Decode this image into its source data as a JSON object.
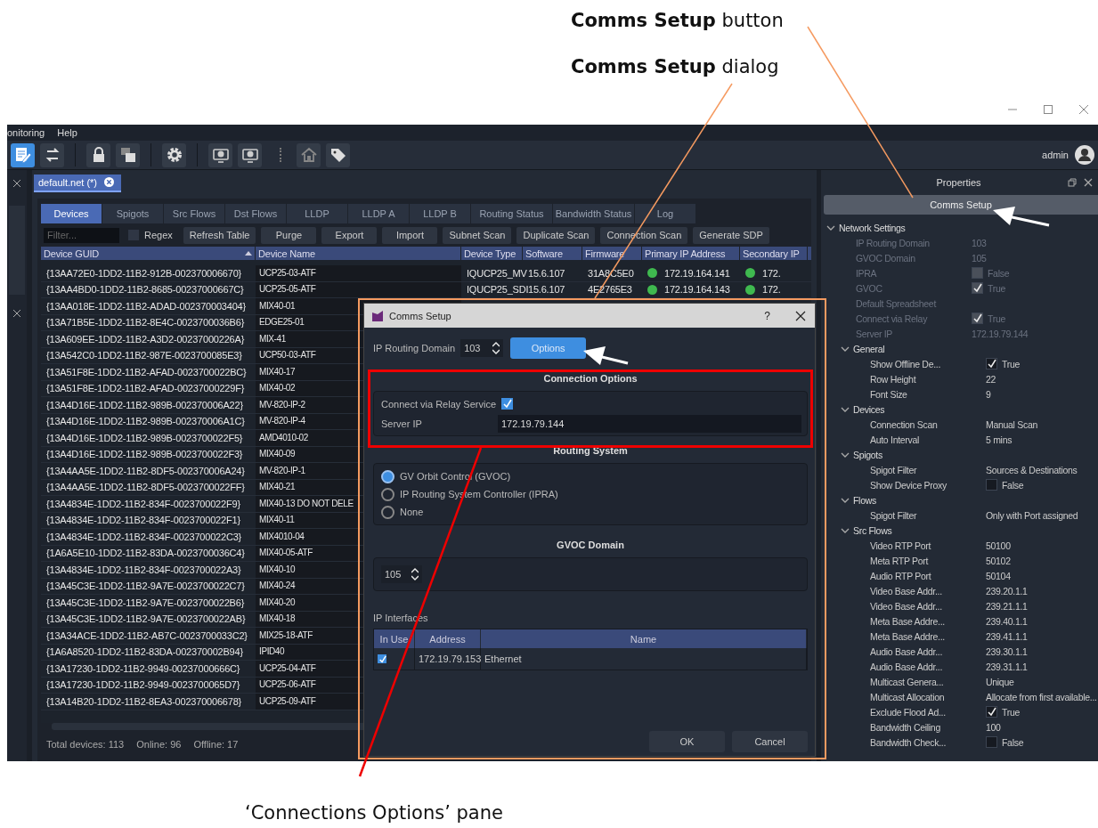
{
  "callouts": [
    {
      "text": "**Comms Setup** button"
    },
    {
      "text": "**Comms Setup** dialog"
    },
    {
      "text": "‘Connections Options’ pane"
    }
  ],
  "menu": [
    "onitoring",
    "Help"
  ],
  "toolbar": [
    {
      "kind": "edit",
      "selected": true
    },
    {
      "kind": "swap",
      "selected": false
    },
    {
      "kind": "lock",
      "selected": false
    },
    {
      "kind": "window",
      "selected": false
    },
    {
      "kind": "gear",
      "selected": false
    },
    {
      "kind": "download",
      "selected": false
    },
    {
      "kind": "upload",
      "selected": false
    },
    {
      "kind": "home",
      "selected": false
    },
    {
      "kind": "tag",
      "selected": false
    }
  ],
  "user": "admin",
  "document_tab": {
    "label": "default.net (*)"
  },
  "tabs": [
    {
      "label": "Devices",
      "selected": true
    },
    {
      "label": "Spigots",
      "selected": false
    },
    {
      "label": "Src Flows",
      "selected": false
    },
    {
      "label": "Dst Flows",
      "selected": false
    },
    {
      "label": "LLDP",
      "selected": false
    },
    {
      "label": "LLDP A",
      "selected": false
    },
    {
      "label": "LLDP B",
      "selected": false
    },
    {
      "label": "Routing Status",
      "selected": false
    },
    {
      "label": "Bandwidth Status",
      "selected": false
    },
    {
      "label": "Log",
      "selected": false
    }
  ],
  "filter": {
    "placeholder": "Filter..."
  },
  "regex": {
    "label": "Regex",
    "checked": false
  },
  "actions": [
    "Refresh Table",
    "Purge",
    "Export",
    "Import",
    "Subnet Scan",
    "Duplicate Scan",
    "Connection Scan",
    "Generate SDP"
  ],
  "table": {
    "columns": [
      "Device GUID",
      "Device Name",
      "Device Type",
      "Software",
      "Firmware",
      "Primary IP Address",
      "Secondary IP"
    ],
    "rows": [
      {
        "guid": "{13AA72E0-1DD2-11B2-912B-002370006670}",
        "name": "UCP25-03-ATF",
        "type": "IQUCP25_MV",
        "software": "15.6.107",
        "firmware": "31A8C5E0",
        "primary_online": true,
        "primary_ip": "172.19.164.141",
        "secondary_online": true,
        "secondary_ip": "172."
      },
      {
        "guid": "{13AA4BD0-1DD2-11B2-8685-00237000667C}",
        "name": "UCP25-05-ATF",
        "type": "IQUCP25_SDI",
        "software": "15.6.107",
        "firmware": "4E2765E3",
        "primary_online": true,
        "primary_ip": "172.19.164.143",
        "secondary_online": true,
        "secondary_ip": "172."
      },
      {
        "guid": "{13AA018E-1DD2-11B2-ADAD-002370003404}",
        "name": "MIX40-01"
      },
      {
        "guid": "{13A71B5E-1DD2-11B2-8E4C-0023700036B6}",
        "name": "EDGE25-01"
      },
      {
        "guid": "{13A609EE-1DD2-11B2-A3D2-00237000226A}",
        "name": "MIX-41"
      },
      {
        "guid": "{13A542C0-1DD2-11B2-987E-0023700085E3}",
        "name": "UCP50-03-ATF"
      },
      {
        "guid": "{13A51F8E-1DD2-11B2-AFAD-0023700022BC}",
        "name": "MIX40-17"
      },
      {
        "guid": "{13A51F8E-1DD2-11B2-AFAD-00237000229F}",
        "name": "MIX40-02"
      },
      {
        "guid": "{13A4D16E-1DD2-11B2-989B-002370006A22}",
        "name": "MV-820-IP-2"
      },
      {
        "guid": "{13A4D16E-1DD2-11B2-989B-002370006A1C}",
        "name": "MV-820-IP-4"
      },
      {
        "guid": "{13A4D16E-1DD2-11B2-989B-0023700022F5}",
        "name": "AMD4010-02"
      },
      {
        "guid": "{13A4D16E-1DD2-11B2-989B-0023700022F3}",
        "name": "MIX40-09"
      },
      {
        "guid": "{13A4AA5E-1DD2-11B2-8DF5-002370006A24}",
        "name": "MV-820-IP-1"
      },
      {
        "guid": "{13A4AA5E-1DD2-11B2-8DF5-0023700022FF}",
        "name": "MIX40-21"
      },
      {
        "guid": "{13A4834E-1DD2-11B2-834F-0023700022F9}",
        "name": "MIX40-13 DO NOT DELE"
      },
      {
        "guid": "{13A4834E-1DD2-11B2-834F-0023700022F1}",
        "name": "MIX40-11"
      },
      {
        "guid": "{13A4834E-1DD2-11B2-834F-0023700022C3}",
        "name": "MIX4010-04"
      },
      {
        "guid": "{1A6A5E10-1DD2-11B2-83DA-0023700036C4}",
        "name": "MIX40-05-ATF"
      },
      {
        "guid": "{13A4834E-1DD2-11B2-834F-0023700022A3}",
        "name": "MIX40-10"
      },
      {
        "guid": "{13A45C3E-1DD2-11B2-9A7E-0023700022C7}",
        "name": "MIX40-24"
      },
      {
        "guid": "{13A45C3E-1DD2-11B2-9A7E-0023700022B6}",
        "name": "MIX40-20"
      },
      {
        "guid": "{13A45C3E-1DD2-11B2-9A7E-0023700022AB}",
        "name": "MIX40-18"
      },
      {
        "guid": "{13A34ACE-1DD2-11B2-AB7C-0023700033C2}",
        "name": "MIX25-18-ATF"
      },
      {
        "guid": "{1A6A8520-1DD2-11B2-83DA-002370002B94}",
        "name": "IPID40"
      },
      {
        "guid": "{13A17230-1DD2-11B2-9949-00237000666C}",
        "name": "UCP25-04-ATF"
      },
      {
        "guid": "{13A17230-1DD2-11B2-9949-0023700065D7}",
        "name": "UCP25-06-ATF"
      },
      {
        "guid": "{13A14B20-1DD2-11B2-8EA3-002370006678}",
        "name": "UCP25-09-ATF"
      }
    ]
  },
  "status_bar": [
    "Total devices: 113",
    "Online: 96",
    "Offline: 17"
  ],
  "properties": {
    "title": "Properties",
    "comms_button": "Comms Setup",
    "tree": [
      {
        "kind": "group",
        "label": "Network Settings",
        "expanded": true,
        "children": [
          {
            "kind": "text",
            "label": "IP Routing Domain",
            "value": "103",
            "disabled": true
          },
          {
            "kind": "text",
            "label": "GVOC Domain",
            "value": "105",
            "disabled": true
          },
          {
            "kind": "check",
            "label": "IPRA",
            "checked": false,
            "value": "False",
            "disabled": true
          },
          {
            "kind": "check",
            "label": "GVOC",
            "checked": true,
            "value": "True",
            "disabled": true
          },
          {
            "kind": "text",
            "label": "Default Spreadsheet",
            "disabled": true
          },
          {
            "kind": "check",
            "label": "Connect via Relay",
            "checked": true,
            "value": "True",
            "disabled": true
          },
          {
            "kind": "text",
            "label": "Server IP",
            "value": "172.19.79.144",
            "disabled": true
          },
          {
            "kind": "group",
            "label": "General",
            "expanded": true,
            "children": [
              {
                "kind": "check",
                "label": "Show Offline De...",
                "checked": true,
                "value": "True",
                "disabled": false
              },
              {
                "kind": "text",
                "label": "Row Height",
                "value": "22",
                "disabled": false
              },
              {
                "kind": "text",
                "label": "Font Size",
                "value": "9",
                "disabled": false
              }
            ]
          },
          {
            "kind": "group",
            "label": "Devices",
            "expanded": true,
            "children": [
              {
                "kind": "text",
                "label": "Connection Scan",
                "value": "Manual Scan",
                "disabled": false
              },
              {
                "kind": "text",
                "label": "Auto Interval",
                "value": "5 mins",
                "disabled": false
              }
            ]
          },
          {
            "kind": "group",
            "label": "Spigots",
            "expanded": true,
            "children": [
              {
                "kind": "text",
                "label": "Spigot Filter",
                "value": "Sources & Destinations",
                "disabled": false
              },
              {
                "kind": "check",
                "label": "Show Device Proxy",
                "checked": false,
                "value": "False",
                "disabled": false
              }
            ]
          },
          {
            "kind": "group",
            "label": "Flows",
            "expanded": true,
            "children": [
              {
                "kind": "text",
                "label": "Spigot Filter",
                "value": "Only with Port assigned",
                "disabled": false
              }
            ]
          },
          {
            "kind": "group",
            "label": "Src Flows",
            "expanded": true,
            "children": [
              {
                "kind": "text",
                "label": "Video RTP Port",
                "value": "50100",
                "disabled": false
              },
              {
                "kind": "text",
                "label": "Meta RTP Port",
                "value": "50102",
                "disabled": false
              },
              {
                "kind": "text",
                "label": "Audio RTP Port",
                "value": "50104",
                "disabled": false
              },
              {
                "kind": "text",
                "label": "Video Base Addr...",
                "value": "239.20.1.1",
                "disabled": false
              },
              {
                "kind": "text",
                "label": "Video Base Addr...",
                "value": "239.21.1.1",
                "disabled": false
              },
              {
                "kind": "text",
                "label": "Meta Base Addre...",
                "value": "239.40.1.1",
                "disabled": false
              },
              {
                "kind": "text",
                "label": "Meta Base Addre...",
                "value": "239.41.1.1",
                "disabled": false
              },
              {
                "kind": "text",
                "label": "Audio Base Addr...",
                "value": "239.30.1.1",
                "disabled": false
              },
              {
                "kind": "text",
                "label": "Audio Base Addr...",
                "value": "239.31.1.1",
                "disabled": false
              },
              {
                "kind": "text",
                "label": "Multicast Genera...",
                "value": "Unique",
                "disabled": false
              },
              {
                "kind": "text",
                "label": "Multicast Allocation",
                "value": "Allocate from first available...",
                "disabled": false
              },
              {
                "kind": "check",
                "label": "Exclude Flood Ad...",
                "checked": true,
                "value": "True",
                "disabled": false
              },
              {
                "kind": "text",
                "label": "Bandwidth Ceiling",
                "value": "100",
                "disabled": false
              },
              {
                "kind": "check",
                "label": "Bandwidth Check...",
                "checked": false,
                "value": "False",
                "disabled": false
              }
            ]
          }
        ]
      }
    ]
  },
  "dialog": {
    "title": "Comms Setup",
    "help": "?",
    "ip_routing_domain": {
      "label": "IP Routing Domain",
      "value": "103"
    },
    "options_button": "Options",
    "connection_options": {
      "title": "Connection Options",
      "relay": {
        "label": "Connect via Relay Service",
        "checked": true
      },
      "server_ip": {
        "label": "Server IP",
        "value": "172.19.79.144"
      }
    },
    "routing_system": {
      "title": "Routing System",
      "options": [
        {
          "label": "GV Orbit Control (GVOC)",
          "selected": true
        },
        {
          "label": "IP Routing System Controller (IPRA)",
          "selected": false
        },
        {
          "label": "None",
          "selected": false
        }
      ]
    },
    "gvoc_domain": {
      "title": "GVOC Domain",
      "value": "105"
    },
    "ip_interfaces": {
      "label": "IP Interfaces",
      "columns": [
        "In Use",
        "Address",
        "Name"
      ],
      "rows": [
        {
          "in_use": true,
          "address": "172.19.79.153",
          "name": "Ethernet"
        }
      ]
    },
    "buttons": [
      "OK",
      "Cancel"
    ]
  }
}
